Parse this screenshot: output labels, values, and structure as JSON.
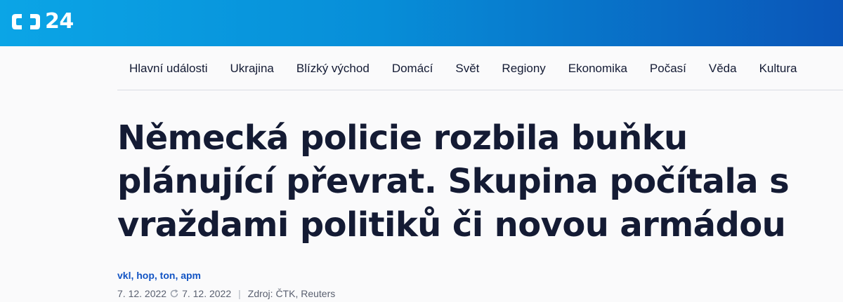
{
  "brand": {
    "logo_text": "24",
    "logo_icon": "ct-logo-icon"
  },
  "nav": {
    "items": [
      {
        "label": "Hlavní události"
      },
      {
        "label": "Ukrajina"
      },
      {
        "label": "Blízký východ"
      },
      {
        "label": "Domácí"
      },
      {
        "label": "Svět"
      },
      {
        "label": "Regiony"
      },
      {
        "label": "Ekonomika"
      },
      {
        "label": "Počasí"
      },
      {
        "label": "Věda"
      },
      {
        "label": "Kultura"
      }
    ]
  },
  "article": {
    "headline": "Německá policie rozbila buňku plánující převrat. Skupina počítala s vraždami politiků či novou armádou",
    "authors": "vkl, hop, ton, apm",
    "published": "7. 12. 2022",
    "updated": "7. 12. 2022",
    "separator": "|",
    "source": "Zdroj: ČTK, Reuters"
  },
  "colors": {
    "header_start": "#0ba5e6",
    "header_end": "#0a55b8",
    "text": "#141b34",
    "author_link": "#1254c4"
  }
}
